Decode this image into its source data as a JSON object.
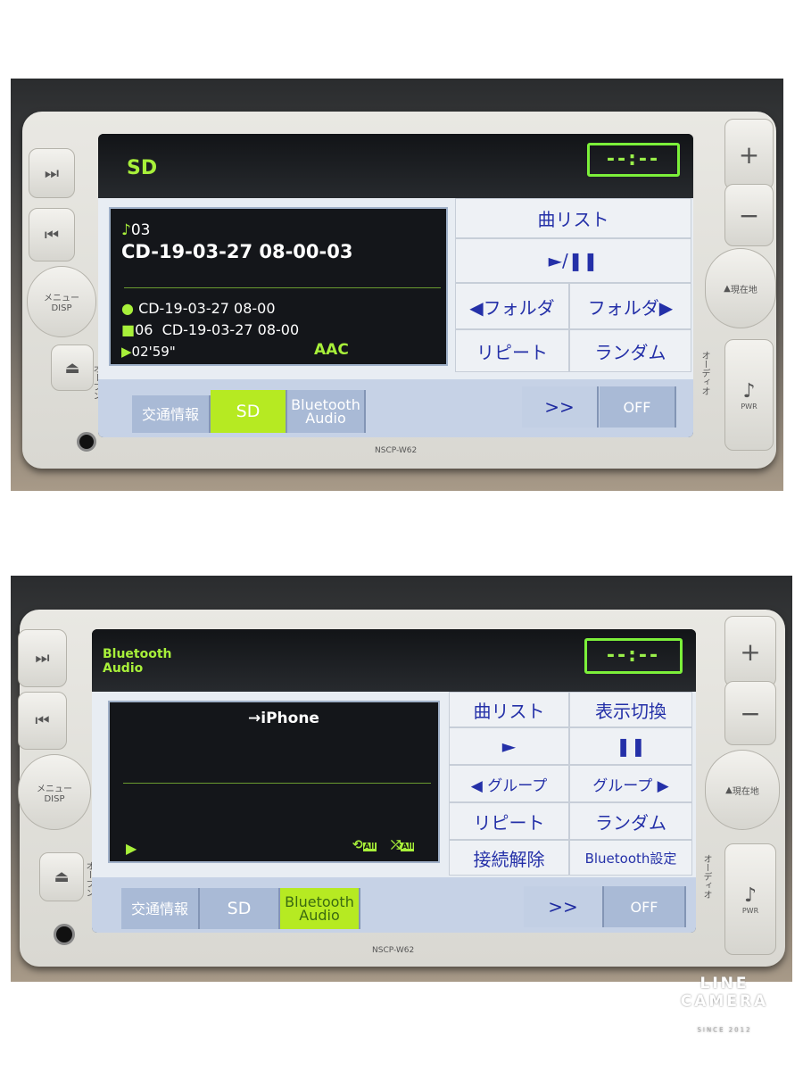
{
  "device": {
    "model": "NSCP-W62",
    "menu_label": "メニュー",
    "disp_label": "DISP",
    "open_label": "オープン",
    "location_label": "現在地",
    "audio_label": "オーディオ",
    "pwr_label": "PWR",
    "plus": "+",
    "minus": "−"
  },
  "top": {
    "source": "SD",
    "clock": "--:--",
    "track_number": "03",
    "track_title": "CD-19-03-27 08-00-03",
    "artist": "CD-19-03-27 08-00",
    "folder_number": "06",
    "folder": "CD-19-03-27 08-00",
    "elapsed": "02'59\"",
    "codec": "AAC",
    "buttons": [
      "曲リスト",
      "►/❚❚",
      "◀フォルダ",
      "フォルダ▶",
      "リピート",
      "ランダム"
    ],
    "tabs": [
      "交通情報",
      "SD",
      "Bluetooth Audio",
      ">>",
      "OFF"
    ],
    "active_tab": "SD"
  },
  "bottom": {
    "source": "Bluetooth Audio",
    "clock": "--:--",
    "device_name": "→iPhone",
    "repeat_badge": "All",
    "shuffle_badge": "All",
    "buttons": [
      "曲リスト",
      "表示切換",
      "►",
      "❚❚",
      "◀ グループ",
      "グループ ▶",
      "リピート",
      "ランダム",
      "接続解除",
      "Bluetooth設定"
    ],
    "tabs": [
      "交通情報",
      "SD",
      "Bluetooth Audio",
      ">>",
      "OFF"
    ],
    "active_tab": "Bluetooth Audio"
  },
  "watermark": {
    "line1": "LINE",
    "line2": "CAMERA",
    "line3": "SINCE 2012"
  },
  "colors": {
    "accent_green": "#a8f03a",
    "button_text": "#2430a8",
    "active_tab": "#b6ea22"
  }
}
